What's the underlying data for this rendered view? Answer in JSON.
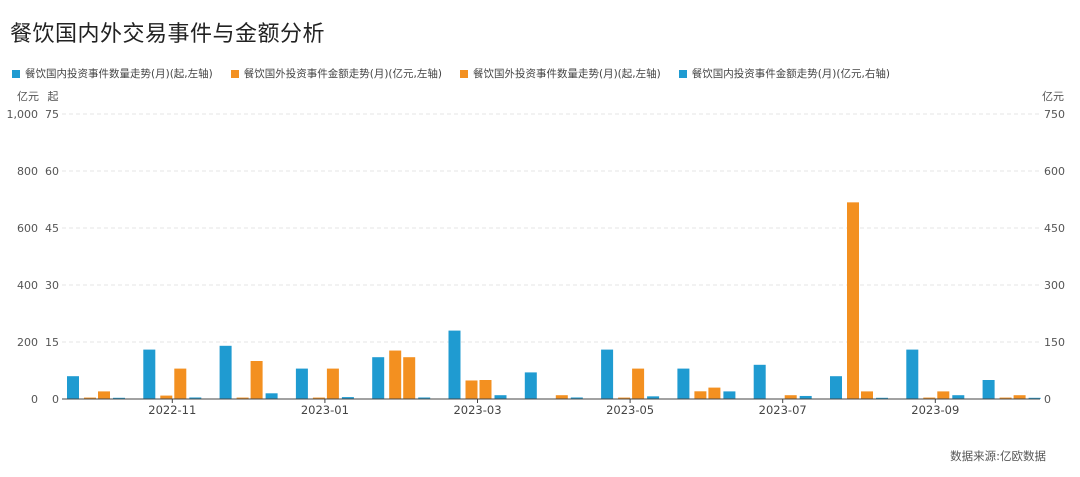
{
  "title": "餐饮国内外交易事件与金额分析",
  "source": "数据来源:亿欧数据",
  "colors": {
    "blue": "#1f9bd1",
    "orange": "#f39020",
    "grid": "#e6e6e6",
    "axis": "#555555"
  },
  "chart_data": {
    "type": "bar",
    "title": "餐饮国内外交易事件与金额分析",
    "left_axis_1_unit": "亿元",
    "left_axis_2_unit": "起",
    "right_axis_unit": "亿元",
    "left_axis_1_ticks": [
      "1,000",
      "800",
      "600",
      "400",
      "200",
      "0"
    ],
    "left_axis_2_ticks": [
      "75",
      "60",
      "45",
      "30",
      "15",
      "0"
    ],
    "right_axis_ticks": [
      "750",
      "600",
      "450",
      "300",
      "150",
      "0"
    ],
    "x_tick_labels": [
      "2022-11",
      "2023-01",
      "2023-03",
      "2023-05",
      "2023-07",
      "2023-09"
    ],
    "x_tick_months": [
      1,
      3,
      5,
      7,
      9,
      11
    ],
    "months": [
      "2022-10",
      "2022-11",
      "2022-12",
      "2023-01",
      "2023-02",
      "2023-03",
      "2023-04",
      "2023-05",
      "2023-06",
      "2023-07",
      "2023-08",
      "2023-09",
      "2023-10"
    ],
    "series": [
      {
        "name": "餐饮国内投资事件数量走势(月)(起,左轴)",
        "color": "#1f9bd1",
        "axis": "left-起",
        "max": 75,
        "values": [
          6,
          13,
          14,
          8,
          11,
          18,
          7,
          13,
          8,
          9,
          6,
          13,
          5
        ]
      },
      {
        "name": "餐饮国外投资事件金额走势(月)(亿元,左轴)",
        "color": "#f39020",
        "axis": "left-亿元",
        "max": 1000,
        "values": [
          5,
          12,
          5,
          5,
          170,
          65,
          0,
          5,
          27,
          0,
          690,
          5,
          5
        ]
      },
      {
        "name": "餐饮国外投资事件数量走势(月)(起,左轴)",
        "color": "#f39020",
        "axis": "left-起",
        "max": 75,
        "values": [
          2,
          8,
          10,
          8,
          11,
          5,
          1,
          8,
          3,
          1,
          2,
          2,
          1
        ]
      },
      {
        "name": "餐饮国内投资事件金额走势(月)(亿元,右轴)",
        "color": "#1f9bd1",
        "axis": "right-亿元",
        "max": 750,
        "values": [
          2,
          4,
          15,
          5,
          4,
          10,
          4,
          7,
          20,
          8,
          3,
          10,
          3
        ]
      }
    ]
  }
}
